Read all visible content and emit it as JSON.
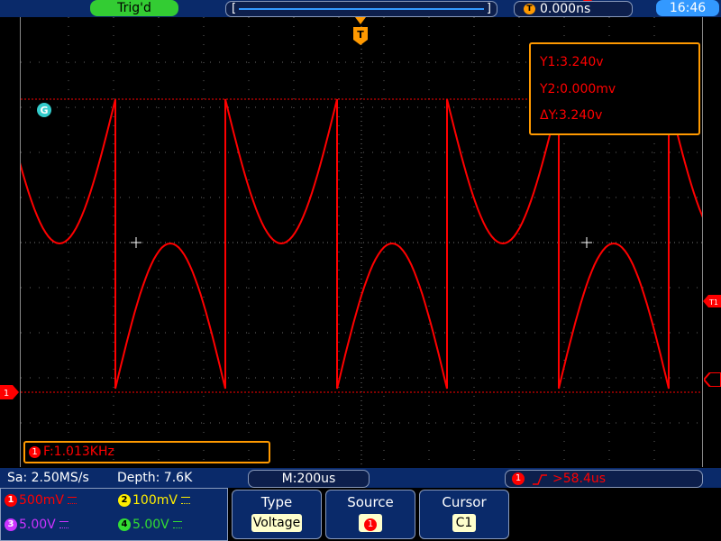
{
  "top": {
    "trigger_status": "Trig'd",
    "memory_left_bracket": "[",
    "memory_right_bracket": "]",
    "trigger_time_badge": "T",
    "trigger_time": "0.000ns",
    "clock": "16:46"
  },
  "screen": {
    "trigger_marker_label": "T",
    "ground_marker_label": "G",
    "channel1_marker_label": "1",
    "trigger_level_marker_label": "T1",
    "measurements": {
      "y1": "Y1:3.240v",
      "y2": "Y2:0.000mv",
      "delta_y": "ΔY:3.240v"
    },
    "frequency": {
      "badge": "1",
      "text": "F:1.013KHz"
    }
  },
  "status": {
    "sample_rate": "Sa: 2.50MS/s",
    "depth": "Depth: 7.6K",
    "timebase": "M:200us",
    "trigger_channel": "1",
    "trigger_delay": ">58.4us"
  },
  "channels": [
    {
      "badge": "1",
      "value": "500mV",
      "color": "#ff0000"
    },
    {
      "badge": "2",
      "value": "100mV",
      "color": "#ffee00"
    },
    {
      "badge": "3",
      "value": "5.00V",
      "color": "#cc33ff"
    },
    {
      "badge": "4",
      "value": "5.00V",
      "color": "#33dd33"
    }
  ],
  "menu": {
    "type_title": "Type",
    "type_value": "Voltage",
    "source_title": "Source",
    "source_value": "1",
    "cursor_title": "Cursor",
    "cursor_value": "C1"
  },
  "colors": {
    "waveform": "#ff0000",
    "accent": "#ff9900",
    "panel": "#0a2a6a"
  }
}
